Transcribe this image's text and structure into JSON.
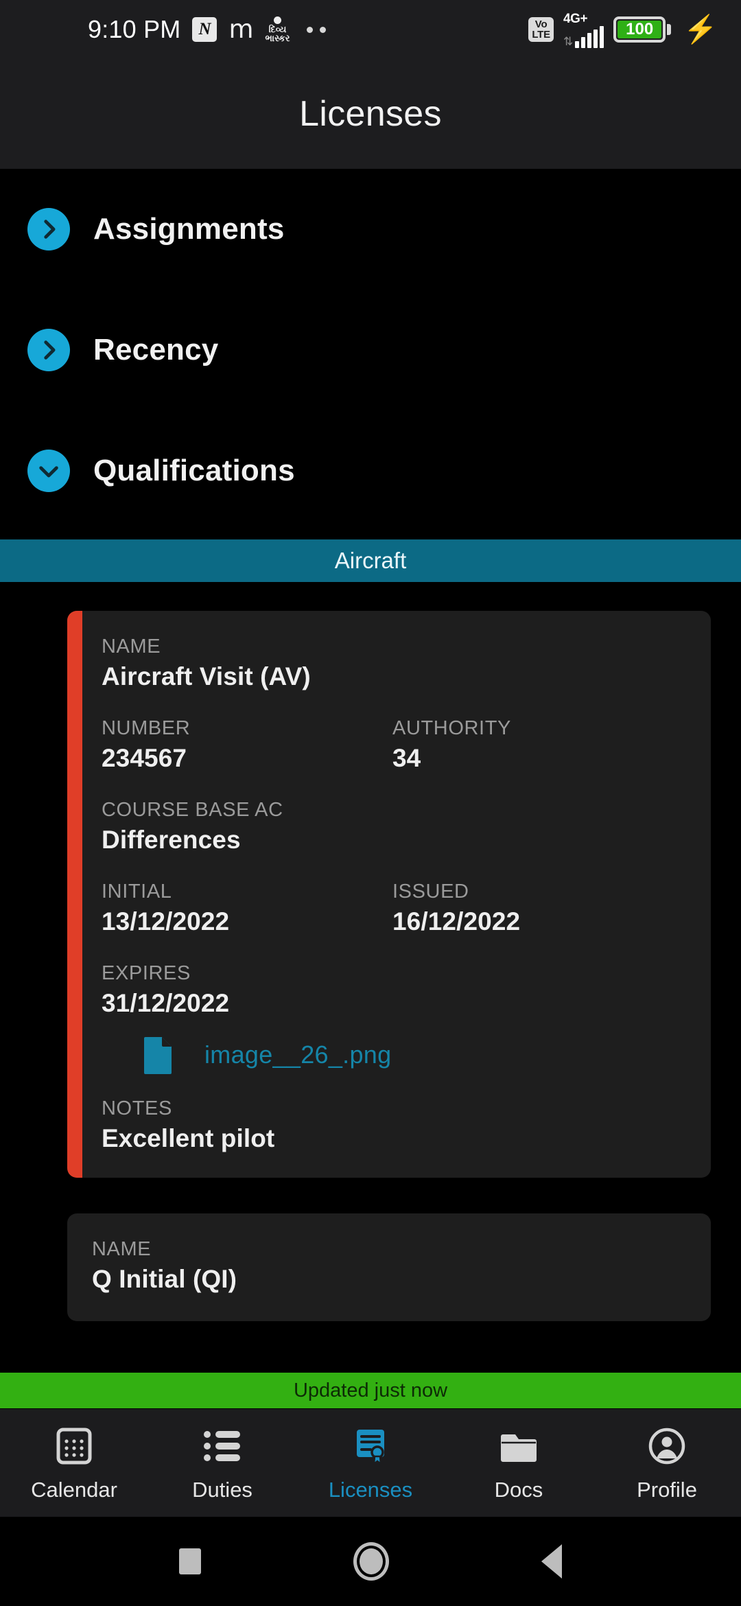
{
  "status_bar": {
    "time": "9:10 PM",
    "notifications": [
      {
        "name": "notification-badge-n",
        "glyph": "N"
      },
      {
        "name": "notification-icon-m",
        "glyph": "m"
      },
      {
        "name": "notification-icon-news-logo",
        "line1": "દિવ્ય",
        "line2": "ભાસ્કર"
      },
      {
        "name": "notification-overflow-dots",
        "glyph": "••"
      }
    ],
    "volte_line1": "Vo",
    "volte_line2": "LTE",
    "network": "4G+",
    "signal_arrows": "⇅",
    "battery_percent": "100",
    "charging": true
  },
  "app_bar": {
    "title": "Licenses"
  },
  "accordions": [
    {
      "label": "Assignments",
      "expanded": false,
      "icon": "chevron-right-icon"
    },
    {
      "label": "Recency",
      "expanded": false,
      "icon": "chevron-right-icon"
    },
    {
      "label": "Qualifications",
      "expanded": true,
      "icon": "chevron-down-icon"
    }
  ],
  "section_band": {
    "label": "Aircraft"
  },
  "cards": [
    {
      "accent_color": "#e03e28",
      "name_label": "NAME",
      "name_value": "Aircraft Visit (AV)",
      "number_label": "NUMBER",
      "number_value": "234567",
      "authority_label": "AUTHORITY",
      "authority_value": "34",
      "course_label": "COURSE BASE AC",
      "course_value": "Differences",
      "initial_label": "INITIAL",
      "initial_value": "13/12/2022",
      "issued_label": "ISSUED",
      "issued_value": "16/12/2022",
      "expires_label": "EXPIRES",
      "expires_value": "31/12/2022",
      "attachment": "image__26_.png",
      "notes_label": "NOTES",
      "notes_value": "Excellent pilot"
    },
    {
      "name_label": "NAME",
      "name_value": "Q Initial (QI)"
    }
  ],
  "updated_banner": {
    "text": "Updated just now",
    "color": "#33b012"
  },
  "bottom_nav": {
    "active_color": "#1a8fc1",
    "items": [
      {
        "label": "Calendar",
        "icon": "calendar-icon",
        "active": false
      },
      {
        "label": "Duties",
        "icon": "list-icon",
        "active": false
      },
      {
        "label": "Licenses",
        "icon": "certificate-icon",
        "active": true
      },
      {
        "label": "Docs",
        "icon": "folder-icon",
        "active": false
      },
      {
        "label": "Profile",
        "icon": "account-circle-icon",
        "active": false
      }
    ]
  },
  "system_nav": [
    {
      "label": "recents",
      "icon": "square-icon"
    },
    {
      "label": "home",
      "icon": "circle-icon"
    },
    {
      "label": "back",
      "icon": "triangle-left-icon"
    }
  ],
  "theme": {
    "accent_cyan": "#17a8d8",
    "band_teal": "#0c6a85",
    "link_teal": "#1585a8",
    "card_bg": "#1e1e1e",
    "page_bg": "#000000"
  }
}
